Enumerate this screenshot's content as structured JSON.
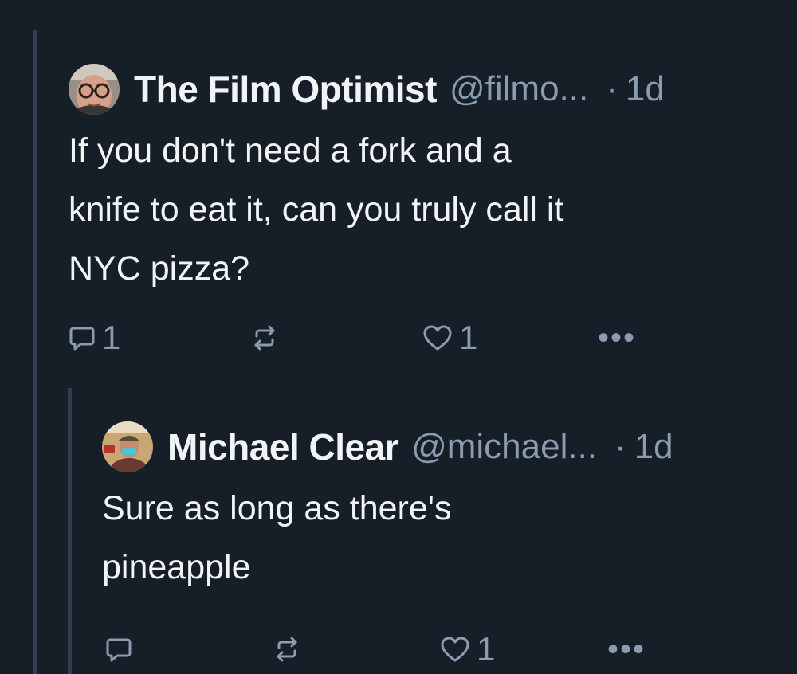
{
  "posts": [
    {
      "display_name": "The Film Optimist",
      "handle": "@filmo...",
      "separator": "·",
      "time": "1d",
      "text": "If you don't need a fork and a\nknife to eat it, can you truly call it\nNYC pizza?",
      "reply_count": "1",
      "repost_count": "",
      "like_count": "1",
      "more_label": "•••"
    },
    {
      "display_name": "Michael Clear",
      "handle": "@michael...",
      "separator": "·",
      "time": "1d",
      "text": "Sure as long as there's\npineapple",
      "reply_count": "",
      "repost_count": "",
      "like_count": "1",
      "more_label": "•••"
    }
  ],
  "icons": [
    "reply-icon",
    "repost-icon",
    "like-icon",
    "more-icon"
  ],
  "colors": {
    "background": "#161e27",
    "thread_line": "#2e3d4f",
    "primary_text": "#f1f3f5",
    "secondary_text": "#8b9bb0"
  }
}
